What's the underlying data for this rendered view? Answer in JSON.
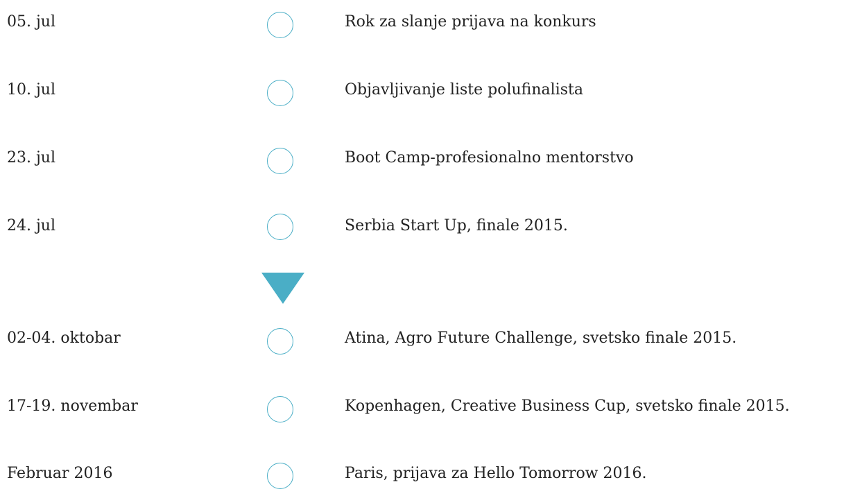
{
  "events": [
    {
      "date": "05. jul",
      "text": "Rok za slanje prijava na konkurs"
    },
    {
      "date": "10. jul",
      "text": "Objavljivanje liste polufinalista"
    },
    {
      "date": "23. jul",
      "text": "Boot Camp-profesionalno mentorstvo"
    },
    {
      "date": "24. jul",
      "text": "Serbia Start Up, finale 2015."
    },
    {
      "date": "02-04. oktobar",
      "text": "Atina, Agro Future Challenge, svetsko finale 2015."
    },
    {
      "date": "17-19. novembar",
      "text": "Kopenhagen, Creative Business Cup, svetsko finale 2015."
    },
    {
      "date": "Februar 2016",
      "text": "Paris, prijava za Hello Tomorrow 2016."
    }
  ],
  "colors": {
    "accent": "#4aaec6",
    "text": "#222222"
  },
  "icons": {
    "marker": "circle-marker-icon",
    "separator": "down-triangle-icon"
  }
}
